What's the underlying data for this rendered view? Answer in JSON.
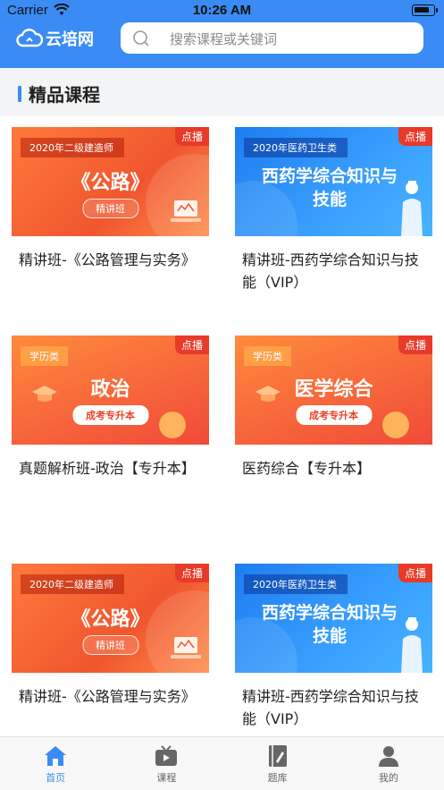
{
  "status_bar": {
    "carrier": "Carrier",
    "time": "10:26 AM"
  },
  "header": {
    "logo_text": "云培网",
    "search_placeholder": "搜索课程或关键词"
  },
  "section": {
    "title": "精品课程"
  },
  "courses": [
    {
      "tag": "点播",
      "banner_top": "2020年二级建造师",
      "banner_title": "《公路》",
      "banner_pill": "精讲班",
      "title": "精讲班-《公路管理与实务》"
    },
    {
      "tag": "点播",
      "banner_top": "2020年医药卫生类",
      "banner_title": "西药学综合知识与技能",
      "title": "精讲班-西药学综合知识与技能（VIP）"
    },
    {
      "tag": "点播",
      "banner_top": "学历类",
      "banner_title": "政治",
      "banner_pill": "成考专升本",
      "title": "真题解析班-政治【专升本】"
    },
    {
      "tag": "点播",
      "banner_top": "学历类",
      "banner_title": "医学综合",
      "banner_pill": "成考专升本",
      "title": "医药综合【专升本】"
    },
    {
      "tag": "点播",
      "banner_top": "2020年二级建造师",
      "banner_title": "《公路》",
      "banner_pill": "精讲班",
      "title": "精讲班-《公路管理与实务》"
    },
    {
      "tag": "点播",
      "banner_top": "2020年医药卫生类",
      "banner_title": "西药学综合知识与技能",
      "title": "精讲班-西药学综合知识与技能（VIP）"
    }
  ],
  "tabs": [
    {
      "label": "首页",
      "icon": "home-icon",
      "active": true
    },
    {
      "label": "课程",
      "icon": "tv-icon",
      "active": false
    },
    {
      "label": "题库",
      "icon": "notebook-icon",
      "active": false
    },
    {
      "label": "我的",
      "icon": "user-icon",
      "active": false
    }
  ],
  "colors": {
    "accent": "#3a8cf4",
    "tag_red": "#e83a28",
    "banner_orange": "#f0562e",
    "banner_blue": "#1e7df0"
  }
}
